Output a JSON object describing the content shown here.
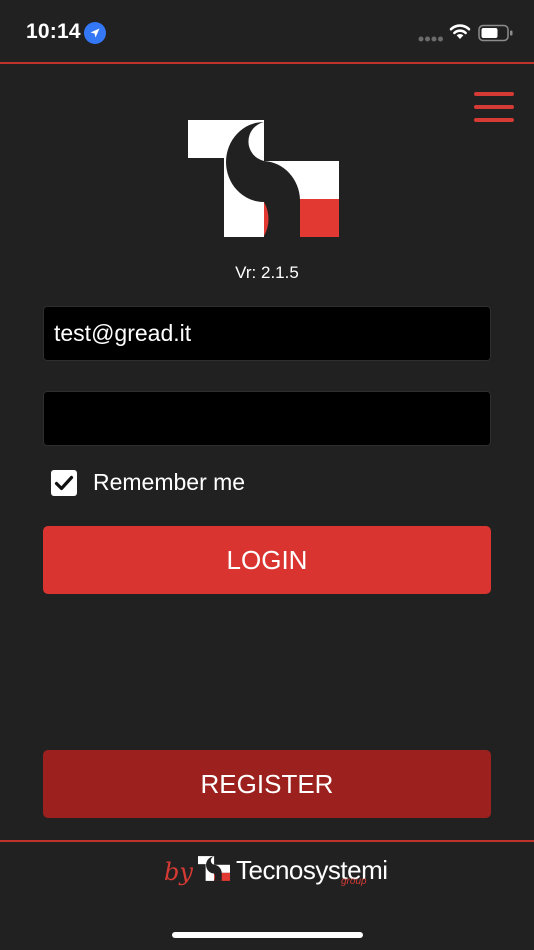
{
  "status_bar": {
    "time": "10:14",
    "icons": [
      "location-arrow-icon",
      "cellular-signal-icon",
      "wifi-icon",
      "battery-icon"
    ]
  },
  "colors": {
    "background": "#212121",
    "accent": "#da3431",
    "register": "#9c211e",
    "field": "#000000"
  },
  "header": {
    "menu_icon": "hamburger-menu-icon"
  },
  "app": {
    "logo_icon": "ts-logo-icon",
    "version": "Vr: 2.1.5"
  },
  "login_form": {
    "email_value": "test@gread.it",
    "email_placeholder": "",
    "password_value": "",
    "password_placeholder": "",
    "remember_label": "Remember me",
    "remember_checked": true,
    "login_label": "LOGIN",
    "register_label": "REGISTER"
  },
  "footer": {
    "by": "by",
    "brand": "Tecnosystemi",
    "group": "group"
  }
}
